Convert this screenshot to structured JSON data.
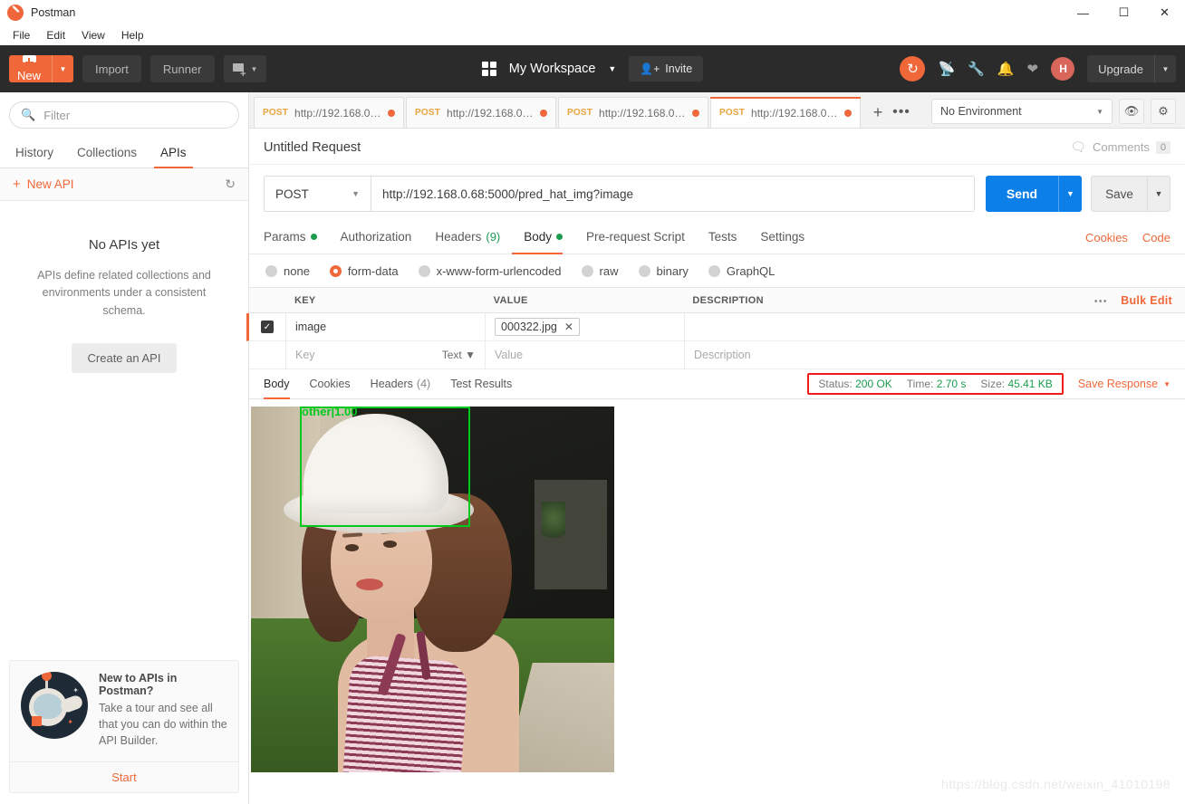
{
  "window": {
    "app_title": "Postman",
    "logo_icon": "postman-logo-icon",
    "minimize": "—",
    "maximize": "☐",
    "close": "✕"
  },
  "menu": {
    "items": [
      "File",
      "Edit",
      "View",
      "Help"
    ]
  },
  "header": {
    "new_label": "New",
    "new_caret": "▼",
    "import_label": "Import",
    "runner_label": "Runner",
    "open_new_caret": "▼",
    "workspace_name": "My Workspace",
    "workspace_caret": "▼",
    "invite_label": "Invite",
    "invite_icon": "person-add-icon",
    "sync_icon": "sync-icon",
    "satellite_icon": "satellite-icon",
    "wrench_icon": "wrench-icon",
    "bell_icon": "bell-icon",
    "heart_icon": "heart-icon",
    "avatar_initials": "H",
    "upgrade_label": "Upgrade",
    "upgrade_caret": "▼"
  },
  "sidebar": {
    "filter_placeholder": "Filter",
    "search_icon": "search-icon",
    "tabs": [
      {
        "label": "History",
        "active": false
      },
      {
        "label": "Collections",
        "active": false
      },
      {
        "label": "APIs",
        "active": true
      }
    ],
    "new_api_label": "New API",
    "new_api_plus": "+",
    "refresh_icon": "refresh-icon",
    "empty_title": "No APIs yet",
    "empty_desc": "APIs define related collections and environments under a consistent schema.",
    "create_api_label": "Create an API",
    "promo": {
      "illustration": "astronaut-illustration",
      "heading": "New to APIs in Postman?",
      "body": "Take a tour and see all that you can do within the API Builder.",
      "cta": "Start"
    }
  },
  "tabs": {
    "items": [
      {
        "method": "POST",
        "url": "http://192.168.0.1...",
        "dirty": true,
        "active": false
      },
      {
        "method": "POST",
        "url": "http://192.168.0.1...",
        "dirty": true,
        "active": false
      },
      {
        "method": "POST",
        "url": "http://192.168.0.6...",
        "dirty": true,
        "active": false
      },
      {
        "method": "POST",
        "url": "http://192.168.0.6...",
        "dirty": true,
        "active": true
      }
    ],
    "add_label": "+",
    "more_label": "•••",
    "environment": "No Environment",
    "environment_caret": "▼",
    "eye_icon": "eye-icon",
    "gear_icon": "gear-icon"
  },
  "request": {
    "title": "Untitled Request",
    "comments_icon": "comment-icon",
    "comments_label": "Comments",
    "comments_count": "0",
    "method": "POST",
    "method_caret": "▼",
    "url": "http://192.168.0.68:5000/pred_hat_img?image",
    "send_label": "Send",
    "send_caret": "▼",
    "save_label": "Save",
    "save_caret": "▼",
    "tabs": [
      {
        "label": "Params",
        "dot": true,
        "count": "",
        "active": false
      },
      {
        "label": "Authorization",
        "dot": false,
        "count": "",
        "active": false
      },
      {
        "label": "Headers",
        "dot": false,
        "count": "(9)",
        "active": false
      },
      {
        "label": "Body",
        "dot": true,
        "count": "",
        "active": true
      },
      {
        "label": "Pre-request Script",
        "dot": false,
        "count": "",
        "active": false
      },
      {
        "label": "Tests",
        "dot": false,
        "count": "",
        "active": false
      },
      {
        "label": "Settings",
        "dot": false,
        "count": "",
        "active": false
      }
    ],
    "right_links": [
      "Cookies",
      "Code"
    ]
  },
  "body": {
    "types": [
      {
        "label": "none",
        "selected": false
      },
      {
        "label": "form-data",
        "selected": true
      },
      {
        "label": "x-www-form-urlencoded",
        "selected": false
      },
      {
        "label": "raw",
        "selected": false
      },
      {
        "label": "binary",
        "selected": false
      },
      {
        "label": "GraphQL",
        "selected": false
      }
    ],
    "columns": [
      "KEY",
      "VALUE",
      "DESCRIPTION"
    ],
    "more_icon": "more-options-icon",
    "bulk_edit": "Bulk Edit",
    "rows": [
      {
        "checked": true,
        "key": "image",
        "value_file": "000322.jpg",
        "remove": "✕",
        "description": ""
      }
    ],
    "new_row": {
      "key_placeholder": "Key",
      "type_label": "Text",
      "type_caret": "▼",
      "value_placeholder": "Value",
      "description_placeholder": "Description"
    }
  },
  "response": {
    "tabs": [
      {
        "label": "Body",
        "count": "",
        "active": true
      },
      {
        "label": "Cookies",
        "count": "",
        "active": false
      },
      {
        "label": "Headers",
        "count": "(4)",
        "active": false
      },
      {
        "label": "Test Results",
        "count": "",
        "active": false
      }
    ],
    "status_label": "Status:",
    "status_value": "200 OK",
    "time_label": "Time:",
    "time_value": "2.70 s",
    "size_label": "Size:",
    "size_value": "45.41 KB",
    "save_response": "Save Response",
    "save_response_caret": "▼",
    "preview": {
      "type": "image",
      "detection_label": "other|1.00",
      "box_color": "#00c91e"
    }
  },
  "watermark": "https://blog.csdn.net/weixin_41010198"
}
